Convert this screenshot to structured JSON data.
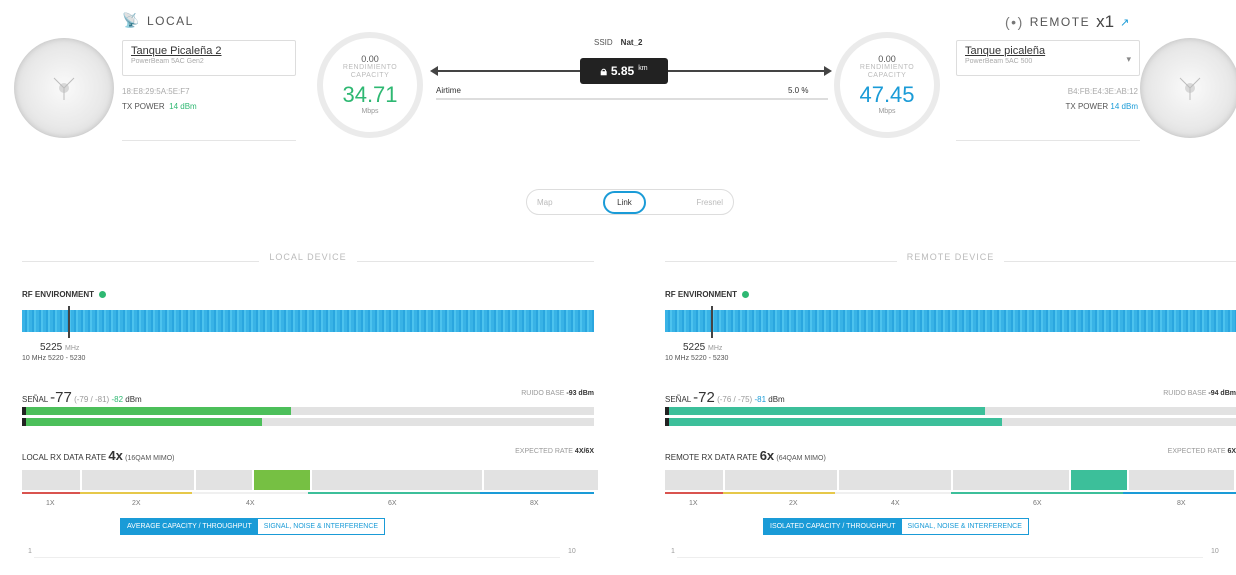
{
  "header": {
    "local": {
      "title": "LOCAL",
      "device_name": "Tanque Picaleña 2",
      "model": "PowerBeam 5AC Gen2",
      "mac": "18:E8:29:5A:5E:F7",
      "tx_power_label": "TX POWER",
      "tx_power_value": "14 dBm"
    },
    "remote": {
      "title": "REMOTE",
      "count": "x1",
      "device_name": "Tanque picaleña",
      "model": "PowerBeam 5AC 500",
      "mac": "B4:FB:E4:3E:AB:12",
      "tx_power_label": "TX POWER",
      "tx_power_value": "14 dBm"
    },
    "local_gauge": {
      "top": "0.00",
      "label": "RENDIMIENTO CAPACITY",
      "value": "34.71",
      "unit": "Mbps"
    },
    "remote_gauge": {
      "top": "0.00",
      "label": "RENDIMIENTO CAPACITY",
      "value": "47.45",
      "unit": "Mbps"
    },
    "link": {
      "ssid_label": "SSID",
      "ssid_value": "Nat_2",
      "distance": "5.85",
      "distance_unit": "km",
      "airtime_label": "Airtime",
      "airtime_value": "5.0 %"
    }
  },
  "tabs": [
    "Map",
    "Link",
    "Fresnel"
  ],
  "local_panel": {
    "section_title": "LOCAL DEVICE",
    "rf_label": "RF ENVIRONMENT",
    "freq": "5225",
    "freq_unit": "MHz",
    "freq_range": "10 MHz 5220 - 5230",
    "signal_label": "SEÑAL",
    "signal_value": "-77",
    "signal_chains": "(-79 / -81)",
    "signal_c2": "-82",
    "signal_unit": "dBm",
    "noise_label": "RUIDO BASE",
    "noise_value": "-93 dBm",
    "signal_bar1_fraction": 0.47,
    "signal_bar2_fraction": 0.42,
    "rate_label": "LOCAL RX DATA RATE",
    "rate_value": "4x",
    "rate_mod": "(16QAM MIMO)",
    "expected_label": "EXPECTED RATE",
    "expected_value": "4X/6X",
    "ticks": [
      "1X",
      "2X",
      "4X",
      "6X",
      "8X"
    ],
    "toggle_on": "AVERAGE CAPACITY / THROUGHPUT",
    "toggle_off": "SIGNAL, NOISE & INTERFERENCE",
    "axis_min": "1",
    "axis_max": "10"
  },
  "remote_panel": {
    "section_title": "REMOTE DEVICE",
    "rf_label": "RF ENVIRONMENT",
    "freq": "5225",
    "freq_unit": "MHz",
    "freq_range": "10 MHz 5220 - 5230",
    "signal_label": "SEÑAL",
    "signal_value": "-72",
    "signal_chains": "(-76 / -75)",
    "signal_c2": "-81",
    "signal_unit": "dBm",
    "noise_label": "RUIDO BASE",
    "noise_value": "-94 dBm",
    "signal_bar1_fraction": 0.56,
    "signal_bar2_fraction": 0.59,
    "rate_label": "REMOTE RX DATA RATE",
    "rate_value": "6x",
    "rate_mod": "(64QAM MIMO)",
    "expected_label": "EXPECTED RATE",
    "expected_value": "6X",
    "ticks": [
      "1X",
      "2X",
      "4X",
      "6X",
      "8X"
    ],
    "toggle_on": "ISOLATED CAPACITY / THROUGHPUT",
    "toggle_off": "SIGNAL, NOISE & INTERFERENCE",
    "axis_min": "1",
    "axis_max": "10"
  },
  "colors": {
    "green": "#2eb872",
    "blue": "#1a9bd7",
    "teal": "#3cbf9a",
    "red": "#d9534f",
    "yellow": "#e6c84a"
  }
}
